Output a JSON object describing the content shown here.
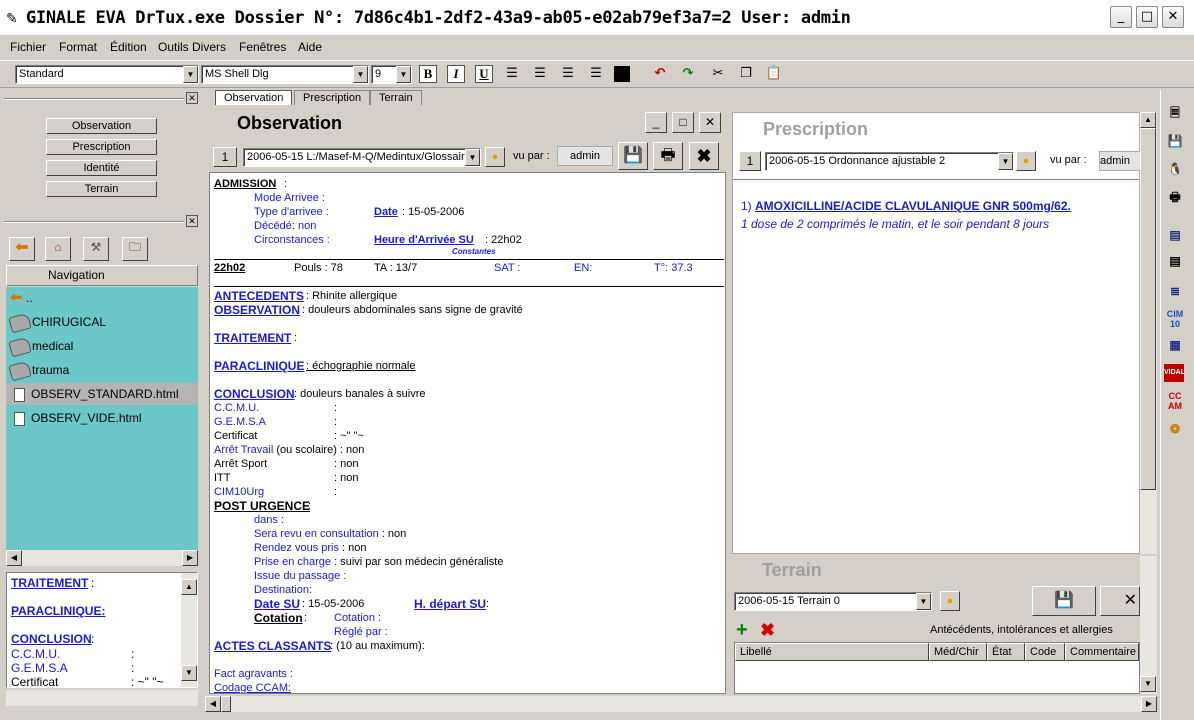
{
  "window": {
    "title": "GINALE EVA  DrTux.exe Dossier N°: 7d86c4b1-2df2-43a9-ab05-e02ab79ef3a7=2  User: admin",
    "min": "_",
    "max": "□",
    "close": "✕"
  },
  "menu": {
    "fichier": "Fichier",
    "format": "Format",
    "edition": "Édition",
    "outils": "Outils Divers",
    "fenetres": "Fenêtres",
    "aide": "Aide"
  },
  "toolbar": {
    "style": "Standard",
    "font": "MS Shell Dlg",
    "size": "9",
    "bold": "B",
    "italic": "I",
    "underline": "U"
  },
  "left": {
    "buttons": [
      "Observation",
      "Prescription",
      "Identité",
      "Terrain"
    ],
    "nav_header": "Navigation",
    "nav_items": [
      "..",
      "CHIRUGICAL",
      "medical",
      "trauma",
      "OBSERV_STANDARD.html",
      "OBSERV_VIDE.html"
    ],
    "preview": {
      "traitement": "TRAITEMENT",
      "traitement_colon": ":",
      "paraclinique": "PARACLINIQUE:",
      "conclusion": "CONCLUSION",
      "conclusion_colon": ":",
      "ccmu": "C.C.M.U.",
      "gemsa": "G.E.M.S.A",
      "certificat": "Certificat",
      "colon": ":",
      "cert_val": ": ~\"       \"~"
    }
  },
  "tabs": [
    "Observation",
    "Prescription",
    "Terrain"
  ],
  "observation": {
    "title": "Observation",
    "num": "1",
    "doc": "2006-05-15 L:/Masef-M-Q/Medintux/Glossaire",
    "vu_par": "vu par :",
    "user": "admin",
    "admission": "ADMISSION",
    "mode_arrivee": "Mode Arrivee :",
    "type_arrivee": "Type d'arrivee :",
    "date_lbl": "Date",
    "date_val": ":  15-05-2006",
    "decede": "Décédé:  non",
    "circonstances": "Circonstances :",
    "heure_lbl": "Heure d'Arrivée SU",
    "heure_val": ":   22h02",
    "constantes": "Constantes",
    "time": "22h02",
    "pouls": "Pouls :   78",
    "ta": "TA :  13/7",
    "sat": "SAT :",
    "en": "EN:",
    "temp": "T°: 37.3",
    "antecedents": "ANTECEDENTS",
    "antecedents_val": ": Rhinite allergique",
    "observation": "OBSERVATION",
    "observation_val": ": douleurs abdominales sans signe de gravité",
    "traitement": "TRAITEMENT",
    "paraclinique": "PARACLINIQUE",
    "paraclinique_val": ": échographie normale",
    "conclusion": "CONCLUSION",
    "conclusion_val": ": douleurs banales à suivre",
    "ccmu": "C.C.M.U.",
    "gemsa": "G.E.M.S.A",
    "colon": ":",
    "certificat": "Certificat",
    "cert_val": ": ~\"       \"~",
    "arret_travail": "Arrêt Travail",
    "arret_travail_rest": " (ou scolaire) :   non",
    "arret_sport": "Arrêt Sport",
    "arret_sport_val": ":    non",
    "itt": "ITT",
    "itt_val": ":    non",
    "cim10": "CIM10Urg",
    "cim10_val": ":",
    "post_urgence": "POST URGENCE",
    "post_colon": ":",
    "dans": "dans :",
    "revu": "Sera revu en consultation",
    "revu_val": " :  non",
    "rendez": "Rendez vous pris",
    "rendez_val": "  :  non",
    "prise": "Prise en charge",
    "prise_val": "    :  suivi par son médecin généraliste",
    "issue": "Issue du passage :",
    "destination": "Destination:",
    "date_su": "Date SU",
    "date_su_val": ":    15-05-2006",
    "depart_su": "H. départ SU",
    "depart_colon": ":",
    "cotation": "Cotation",
    "cotation_colon": ":",
    "cotation2": "Cotation    :",
    "regle": "Réglé par :",
    "actes": "ACTES CLASSANTS",
    "actes_val": ": (10 au maximum):",
    "fact": "Fact agravants    :",
    "ccam": "Codage CCAM:"
  },
  "prescription": {
    "title": "Prescription",
    "num": "1",
    "doc": "2006-05-15 Ordonnance ajustable 2",
    "vu_par": "vu par :",
    "user": "admin",
    "item_num": "1)",
    "item_drug": "AMOXICILLINE/ACIDE CLAVULANIQUE GNR 500mg/62.",
    "item_dose": "1 dose de 2 comprimés  le matin, et le soir pendant  8 jours"
  },
  "terrain": {
    "title": "Terrain",
    "doc": "2006-05-15 Terrain 0",
    "caption": "Antécédents, intolérances et allergies",
    "columns": [
      "Libellé",
      "Méd/Chir",
      "État",
      "Code",
      "Commentaire"
    ]
  },
  "sidebar_icons": [
    "CIM 10",
    "VIDAL",
    "CC AM"
  ]
}
